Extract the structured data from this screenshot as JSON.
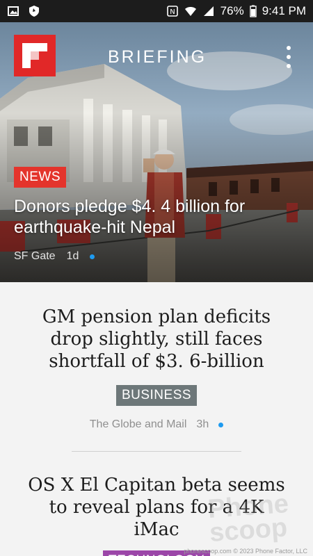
{
  "status_bar": {
    "battery": "76%",
    "time": "9:41 PM",
    "icons": [
      "gallery-icon",
      "shield-icon",
      "nfc-icon",
      "wifi-icon",
      "signal-icon"
    ]
  },
  "app": {
    "brand": "BRIEFING",
    "logo": "flipboard-logo",
    "menu_icon": "overflow-menu-icon"
  },
  "colors": {
    "news_tag": "#e4342c",
    "business_tag": "#6d7779",
    "technology_tag": "#9b46a8",
    "unread_dot": "#1e9bf0",
    "logo_red": "#e12828"
  },
  "hero": {
    "tag": "NEWS",
    "title": "Donors pledge $4. 4 billion for earthquake-hit Nepal",
    "source": "SF Gate",
    "age": "1d"
  },
  "stories": [
    {
      "title": "GM pension plan deficits drop slightly, still faces shortfall of $3. 6-billion",
      "tag": "BUSINESS",
      "source": "The Globe and Mail",
      "age": "3h"
    },
    {
      "title": "OS X El Capitan beta seems to reveal plans for a 4K iMac",
      "tag": "TECHNOLOGY"
    }
  ],
  "watermark": {
    "logo": "Phone scoop",
    "text": "phonescoop.com   © 2023 Phone Factor, LLC"
  }
}
